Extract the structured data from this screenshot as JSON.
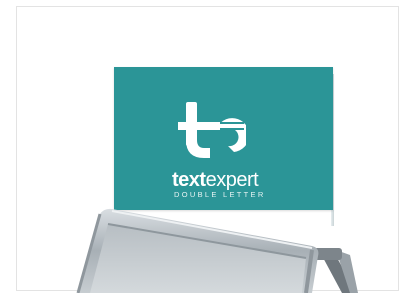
{
  "image": {
    "description_colors": {
      "board": "#2b9597",
      "logo": "#ffffff",
      "frame": "#b9c0c5"
    }
  },
  "sign": {
    "logo_mark": "te",
    "brand_bold": "text",
    "brand_light": "expert",
    "tagline": "DOUBLE LETTER"
  }
}
